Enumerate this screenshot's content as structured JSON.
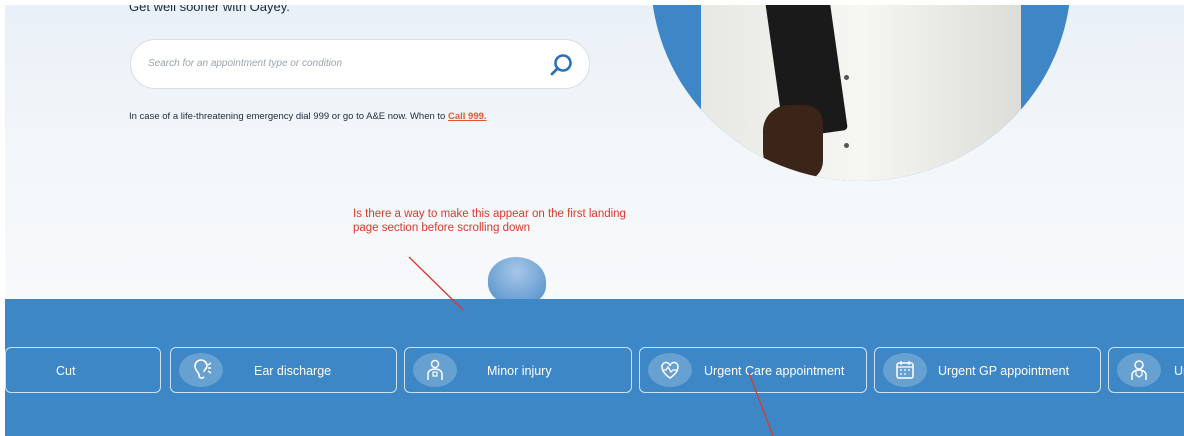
{
  "hero": {
    "tagline": "Get well sooner with Oayey.",
    "search": {
      "placeholder": "Search for an appointment type or condition"
    },
    "emergency": {
      "text": "In case of a life-threatening emergency dial 999 or go to A&E now. When to ",
      "link": "Call 999."
    }
  },
  "annotation": {
    "text": "Is there a way to make this appear on the first landing page section before scrolling down"
  },
  "services": [
    {
      "label": "Cut",
      "icon": ""
    },
    {
      "label": "Ear discharge",
      "icon": "ear-icon"
    },
    {
      "label": "Minor injury",
      "icon": "injured-person-icon"
    },
    {
      "label": "Urgent Care appointment",
      "icon": "heartbeat-icon"
    },
    {
      "label": "Urgent GP appointment",
      "icon": "calendar-icon"
    },
    {
      "label": "Ur",
      "icon": "doctor-icon"
    }
  ],
  "colors": {
    "accent_blue": "#3d87c6",
    "annotation_red": "#d83a2c",
    "link_orange": "#e4572e"
  }
}
